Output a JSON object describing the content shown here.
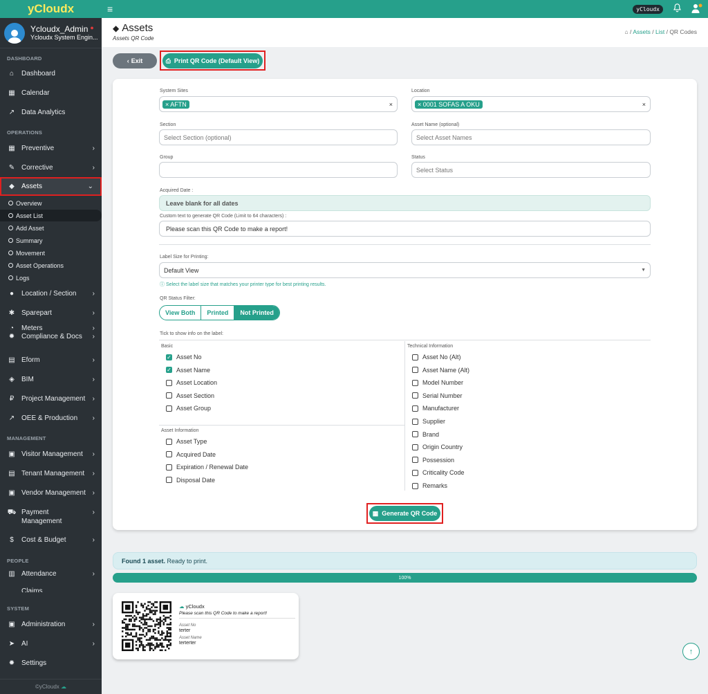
{
  "brand": "yCloudx",
  "user": {
    "name": "Ycloudx_Admin",
    "role": "Ycloudx System Engin..."
  },
  "topbar": {
    "pill": "yCloudx"
  },
  "sidebar": {
    "sections": {
      "dashboard": "DASHBOARD",
      "operations": "OPERATIONS",
      "management": "MANAGEMENT",
      "people": "PEOPLE",
      "system": "SYSTEM"
    },
    "items": {
      "dashboard": "Dashboard",
      "calendar": "Calendar",
      "analytics": "Data Analytics",
      "preventive": "Preventive",
      "corrective": "Corrective",
      "assets": "Assets",
      "location": "Location / Section",
      "sparepart": "Sparepart",
      "meters": "Meters",
      "compliance": "Compliance & Docs",
      "eform": "Eform",
      "bim": "BIM",
      "project": "Project Management",
      "oee": "OEE & Production",
      "visitor": "Visitor Management",
      "tenant": "Tenant Management",
      "vendor": "Vendor Management",
      "payment1": "Payment",
      "payment2": "Management",
      "cost": "Cost & Budget",
      "attendance": "Attendance",
      "claims": "Claims",
      "admin": "Administration",
      "ai": "AI",
      "settings": "Settings"
    },
    "subitems": {
      "overview": "Overview",
      "assetlist": "Asset List",
      "addasset": "Add Asset",
      "summary": "Summary",
      "movement": "Movement",
      "operations": "Asset Operations",
      "logs": "Logs"
    },
    "footer": "©yCloudx"
  },
  "page": {
    "title": "Assets",
    "subtitle": "Assets QR Code",
    "breadcrumb": {
      "assets": "Assets",
      "list": "List",
      "current": "QR Codes",
      "sep": "/"
    }
  },
  "buttons": {
    "exit": "Exit",
    "print": "Print QR Code (Default View)",
    "generate": "Generate QR Code"
  },
  "form": {
    "sites_label": "System Sites",
    "sites_chip": "× AFTN",
    "location_label": "Location",
    "location_chip": "× 0001 SOFAS A OKU",
    "section_label": "Section",
    "section_ph": "Select Section (optional)",
    "assetname_label": "Asset Name (optional)",
    "assetname_ph": "Select Asset Names",
    "group_label": "Group",
    "status_label": "Status",
    "status_ph": "Select Status",
    "acquired_label": "Acquired Date :",
    "acquired_value": "Leave blank for all dates",
    "custom_label": "Custom text to generate QR Code (Limit to 64 characters) :",
    "custom_value": "Please scan this QR Code to make a report!",
    "labelsize_label": "Label Size for Printing:",
    "labelsize_value": "Default View",
    "labelsize_note": "Select the label size that matches your printer type for best printing results.",
    "qrfilter_label": "QR Status Filter:",
    "qrfilter": [
      "View Both",
      "Printed",
      "Not Printed"
    ],
    "tick_label": "Tick to show info on the label:",
    "basic_title": "Basic",
    "basic": [
      {
        "label": "Asset No",
        "checked": true
      },
      {
        "label": "Asset Name",
        "checked": true
      },
      {
        "label": "Asset Location",
        "checked": false
      },
      {
        "label": "Asset Section",
        "checked": false
      },
      {
        "label": "Asset Group",
        "checked": false
      }
    ],
    "info_title": "Asset Information",
    "info": [
      {
        "label": "Asset Type",
        "checked": false
      },
      {
        "label": "Acquired Date",
        "checked": false
      },
      {
        "label": "Expiration / Renewal Date",
        "checked": false
      },
      {
        "label": "Disposal Date",
        "checked": false
      }
    ],
    "tech_title": "Technical Information",
    "tech": [
      {
        "label": "Asset No (Alt)",
        "checked": false
      },
      {
        "label": "Asset Name (Alt)",
        "checked": false
      },
      {
        "label": "Model Number",
        "checked": false
      },
      {
        "label": "Serial Number",
        "checked": false
      },
      {
        "label": "Manufacturer",
        "checked": false
      },
      {
        "label": "Supplier",
        "checked": false
      },
      {
        "label": "Brand",
        "checked": false
      },
      {
        "label": "Origin Country",
        "checked": false
      },
      {
        "label": "Possession",
        "checked": false
      },
      {
        "label": "Criticality Code",
        "checked": false
      },
      {
        "label": "Remarks",
        "checked": false
      }
    ]
  },
  "result": {
    "found_bold": "Found 1 asset.",
    "found_rest": "Ready to print.",
    "progress_label": "100%",
    "progress": 1.0
  },
  "qrlabel": {
    "brand": "yCloudx",
    "message": "Please scan this QR Code to make a report!",
    "asset_no_label": "Asset No",
    "asset_no": "terter",
    "asset_name_label": "Asset Name",
    "asset_name": "terterter"
  }
}
